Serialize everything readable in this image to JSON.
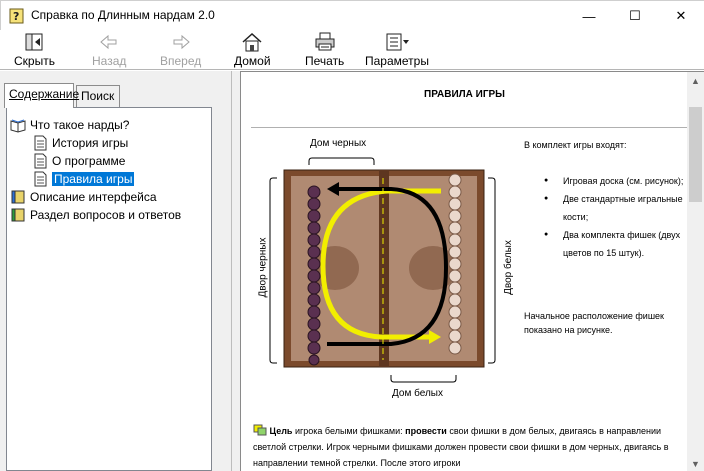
{
  "window": {
    "title": "Справка по Длинным нардам 2.0",
    "controls": {
      "minimize": "—",
      "maximize": "☐",
      "close": "✕"
    }
  },
  "toolbar": {
    "items": [
      {
        "label": "Скрыть",
        "icon": "hide-icon",
        "enabled": true
      },
      {
        "label": "Назад",
        "icon": "back-arrow-icon",
        "enabled": false
      },
      {
        "label": "Вперед",
        "icon": "forward-arrow-icon",
        "enabled": false
      },
      {
        "label": "Домой",
        "icon": "home-icon",
        "enabled": true
      },
      {
        "label": "Печать",
        "icon": "printer-icon",
        "enabled": true
      },
      {
        "label": "Параметры",
        "icon": "options-icon",
        "enabled": true
      }
    ]
  },
  "nav": {
    "tabs": [
      {
        "label": "Содержание",
        "active": true
      },
      {
        "label": "Поиск",
        "active": false
      }
    ],
    "tree": [
      {
        "label": "Что такое нарды?",
        "icon": "open-book-icon",
        "level": 0,
        "selected": false
      },
      {
        "label": "История игры",
        "icon": "page-icon",
        "level": 1,
        "selected": false
      },
      {
        "label": "О программе",
        "icon": "page-icon",
        "level": 1,
        "selected": false
      },
      {
        "label": "Правила игры",
        "icon": "page-icon",
        "level": 1,
        "selected": true
      },
      {
        "label": "Описание интерфейса",
        "icon": "closed-book-icon",
        "level": 0,
        "selected": false
      },
      {
        "label": "Раздел вопросов и ответов",
        "icon": "closed-book-icon",
        "level": 0,
        "selected": false
      }
    ]
  },
  "content": {
    "title": "ПРАВИЛА ИГРЫ",
    "labels": {
      "black_home": "Дом черных",
      "white_home": "Дом белых",
      "black_yard": "Двор черных",
      "white_yard": "Двор белых"
    },
    "kit_title": "В комплект игры входят:",
    "kit_items": [
      "Игровая доска (см. рисунок);",
      "Две стандартные игральные кости;",
      "Два комплекта фишек (двух цветов по 15 штук)."
    ],
    "initial_position": "Начальное расположение фишек показано на рисунке.",
    "goal": {
      "lead": "Цель",
      "text1": " игрока белыми фишками: ",
      "emph": "провести",
      "text2": " свои фишки в дом белых, двигаясь в направлении светлой стрелки. Игрок черными фишками должен провести свои фишки в дом черных, двигаясь в направлении темной стрелки. После этого игроки"
    }
  },
  "colors": {
    "selection": "#0078d7",
    "board_frame": "#7b4a2c",
    "board_inner": "#b08a72",
    "white_arrow": "#f2ee00",
    "black_arrow": "#000000"
  }
}
